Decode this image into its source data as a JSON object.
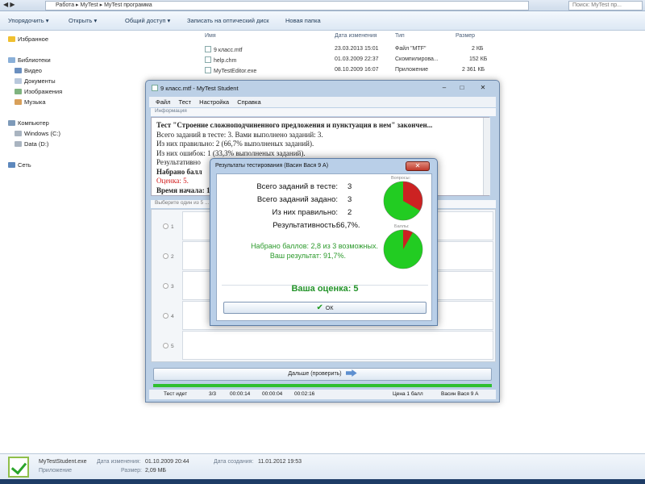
{
  "explorer": {
    "nav_arrows": "◀ ▶",
    "breadcrumb": [
      "Работа",
      "MyTest",
      "MyTest программа"
    ],
    "search_placeholder": "Поиск: MyTest пр...",
    "toolbar": [
      "Упорядочить ▾",
      "Открыть ▾",
      "Общий доступ ▾",
      "Записать на оптический диск",
      "Новая папка"
    ],
    "nav_items": [
      {
        "label": "Избранное",
        "icon": "star-icon"
      },
      {
        "label": "Библиотеки",
        "icon": "library-icon"
      },
      {
        "label": "Видео",
        "icon": "video-icon"
      },
      {
        "label": "Документы",
        "icon": "documents-icon"
      },
      {
        "label": "Изображения",
        "icon": "images-icon"
      },
      {
        "label": "Музыка",
        "icon": "music-icon"
      },
      {
        "label": "Компьютер",
        "icon": "computer-icon"
      },
      {
        "label": "Windows (C:)",
        "icon": "drive-icon"
      },
      {
        "label": "Data (D:)",
        "icon": "drive-icon"
      },
      {
        "label": "Сеть",
        "icon": "network-icon"
      }
    ],
    "columns": [
      "Имя",
      "Дата изменения",
      "Тип",
      "Размер"
    ],
    "files": [
      {
        "name": "9 класс.mtf",
        "date": "23.03.2013 15:01",
        "type": "Файл \"MTF\"",
        "size": "2 КБ"
      },
      {
        "name": "help.chm",
        "date": "01.03.2009 22:37",
        "type": "Скомпилирова...",
        "size": "152 КБ"
      },
      {
        "name": "MyTestEditor.exe",
        "date": "08.10.2009 16:07",
        "type": "Приложение",
        "size": "2 361 КБ"
      }
    ],
    "status": {
      "name": "MyTestStudent.exe",
      "kind": "Приложение",
      "modified_label": "Дата изменения:",
      "modified": "01.10.2009 20:44",
      "size_label": "Размер:",
      "size": "2,09 МБ",
      "created_label": "Дата создания:",
      "created": "11.01.2012 19:53"
    }
  },
  "mytest": {
    "title": "9 класс.mtf - MyTest Student",
    "window_buttons": [
      "–",
      "□",
      "✕"
    ],
    "menu": [
      "Файл",
      "Тест",
      "Настройка",
      "Справка"
    ],
    "info_label": "Информация",
    "report_lines": [
      "Тест \"Строение сложноподчиненного предложения и пунктуация в нем\" закончен...",
      "Всего заданий в тесте: 3. Вами выполнено заданий: 3.",
      "Из них правильно: 2 (66,7% выполненых заданий).",
      "Из них ошибок: 1 (33,3% выполненых заданий).",
      "Результативно",
      "Набрано балл",
      "Оценка: 5.",
      "Время начала: 1"
    ],
    "question_hint": "Выберите один из 5 ...",
    "answers": [
      "1",
      "2",
      "3",
      "4",
      "5"
    ],
    "next_button": "Дальше (проверить)",
    "progress": 1.0,
    "statusbar": [
      "Тест идет",
      "3/3",
      "00:00:14",
      "00:00:04",
      "00:02:16",
      "Цена 1 балл",
      "Васин Вася 9 А"
    ]
  },
  "dialog": {
    "title": "Результаты тестирования (Васин Вася 9 А)",
    "close": "✕",
    "rows": [
      {
        "label": "Всего заданий в тесте:",
        "value": "3"
      },
      {
        "label": "Всего заданий задано:",
        "value": "3"
      },
      {
        "label": "Из них правильно:",
        "value": "2"
      },
      {
        "label": "Результативность:",
        "value": "66,7%."
      }
    ],
    "score_line": "Набрано баллов: 2,8 из 3 возможных.",
    "result_line": "Ваш результат: 91,7%.",
    "grade": "Ваша оценка: 5",
    "ok_button": "ОК",
    "pie_questions_label": "Вопросы:",
    "pie_points_label": "Баллы:",
    "pie_questions_correct_fraction": 0.667,
    "pie_points_correct_fraction": 0.917,
    "colors": {
      "correct": "#22cc22",
      "wrong": "#cc2222",
      "grade": "#23932a"
    }
  }
}
